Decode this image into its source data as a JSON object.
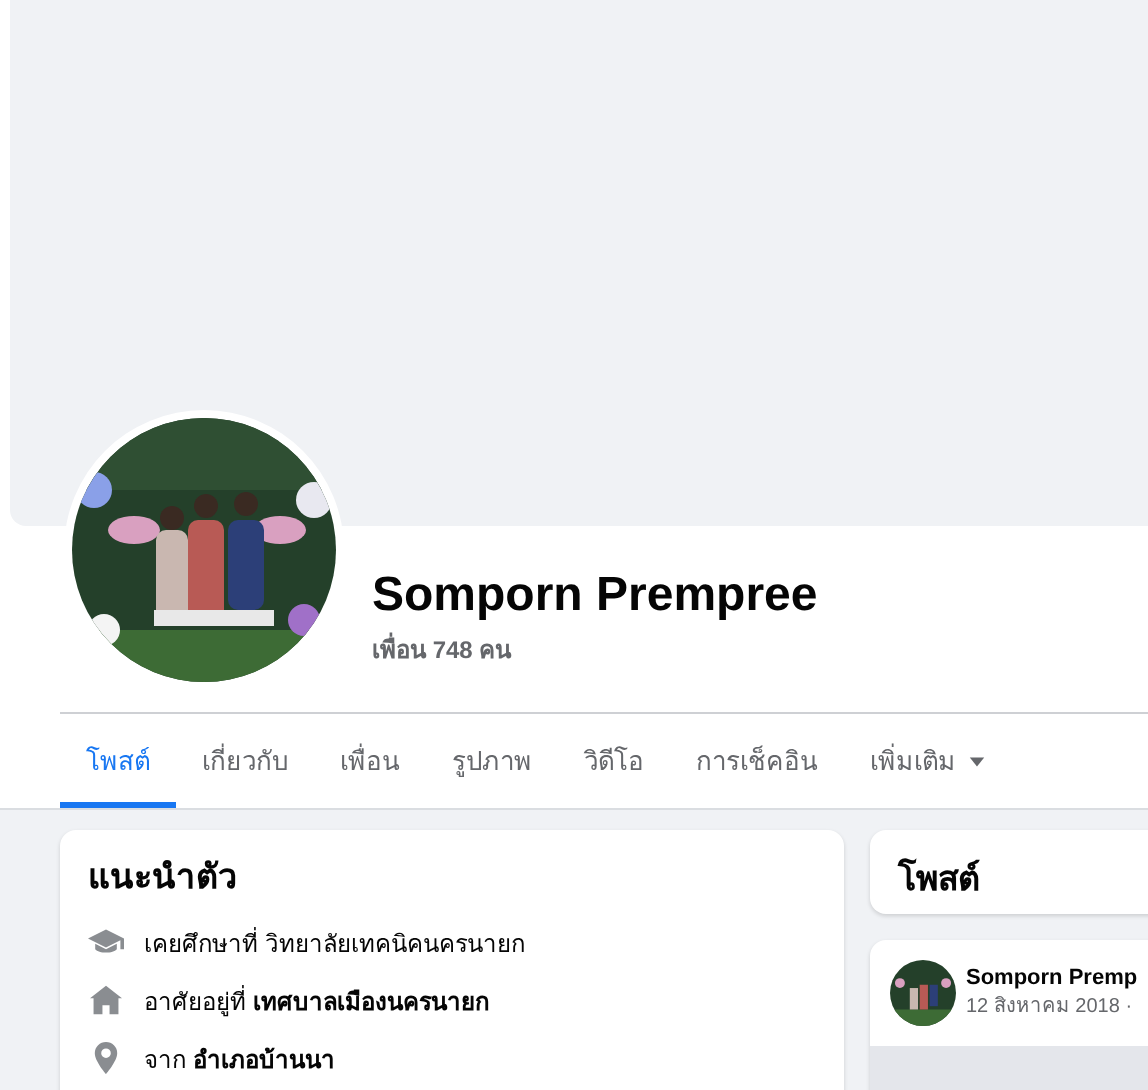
{
  "profile": {
    "name": "Somporn Prempree",
    "friends": "เพื่อน 748 คน"
  },
  "tabs": [
    {
      "label": "โพสต์",
      "selected": true
    },
    {
      "label": "เกี่ยวกับ",
      "selected": false
    },
    {
      "label": "เพื่อน",
      "selected": false
    },
    {
      "label": "รูปภาพ",
      "selected": false
    },
    {
      "label": "วิดีโอ",
      "selected": false
    },
    {
      "label": "การเช็คอิน",
      "selected": false
    },
    {
      "label": "เพิ่มเติม",
      "selected": false,
      "kind": "menu"
    }
  ],
  "intro": {
    "title": "แนะนำตัว",
    "items": [
      {
        "kind": "education",
        "text": "เคยศึกษาที่ วิทยาลัยเทคนิคนครนายก"
      },
      {
        "kind": "home",
        "text": "อาศัยอยู่ที่ **เทศบาลเมืองนครนายก**"
      },
      {
        "kind": "location",
        "text": "จาก **อำเภอบ้านนา**"
      }
    ]
  },
  "posts": {
    "title": "โพสต์",
    "post": {
      "author": "Somporn Premp",
      "date": "12 สิงหาคม 2018 ·"
    }
  }
}
